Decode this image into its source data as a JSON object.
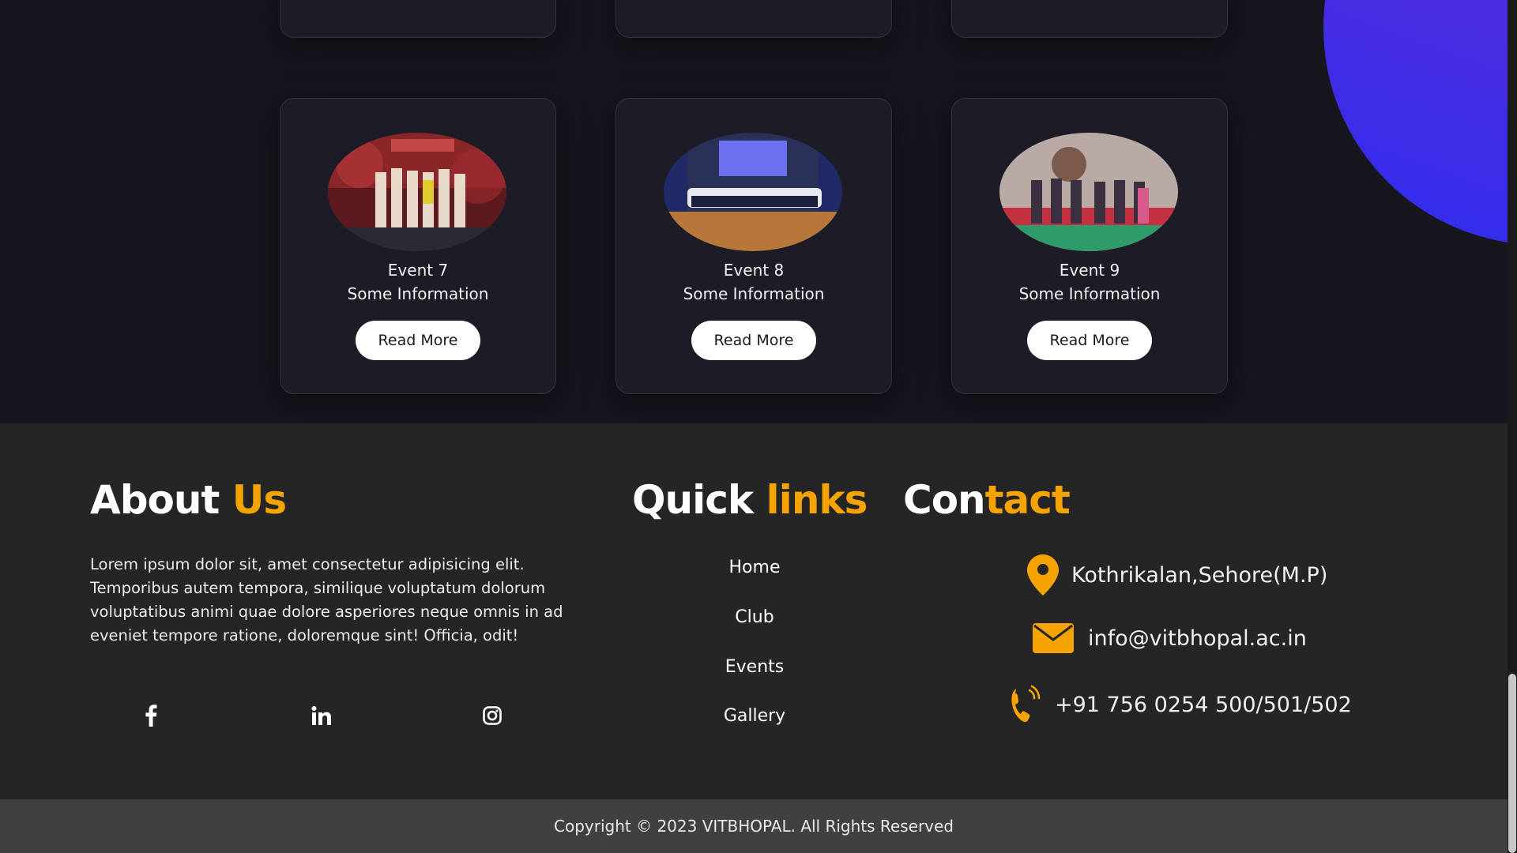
{
  "colors": {
    "background": "#17161f",
    "card": "#1c1b26",
    "footer": "#252525",
    "copyright_bar": "#404040",
    "accent": "#f5a300",
    "decor_gradient_start": "#6a2fc9",
    "decor_gradient_end": "#2f2bef"
  },
  "events": {
    "cards": [
      {
        "title": "Event 7",
        "info": "Some Information",
        "button_label": "Read More"
      },
      {
        "title": "Event 8",
        "info": "Some Information",
        "button_label": "Read More"
      },
      {
        "title": "Event 9",
        "info": "Some Information",
        "button_label": "Read More"
      }
    ]
  },
  "footer": {
    "about": {
      "heading_main": "About ",
      "heading_accent": "Us",
      "text": "Lorem ipsum dolor sit, amet consectetur adipisicing elit. Temporibus autem tempora, similique voluptatum dolorum voluptatibus animi quae dolore asperiores neque omnis in ad eveniet tempore ratione, doloremque sint! Officia, odit!",
      "social": [
        {
          "icon": "facebook-icon"
        },
        {
          "icon": "linkedin-icon"
        },
        {
          "icon": "instagram-icon"
        }
      ]
    },
    "quick_links": {
      "heading_main": "Quick ",
      "heading_accent": "links",
      "items": [
        "Home",
        "Club",
        "Events",
        "Gallery"
      ]
    },
    "contact": {
      "heading_main": "Con",
      "heading_accent": "tact",
      "address": "Kothrikalan,Sehore(M.P)",
      "email": "info@vitbhopal.ac.in",
      "phone": "+91 756 0254 500/501/502",
      "icons": [
        "map-pin-icon",
        "envelope-icon",
        "phone-icon"
      ]
    },
    "copyright": "Copyright © 2023 VITBHOPAL. All Rights Reserved"
  }
}
